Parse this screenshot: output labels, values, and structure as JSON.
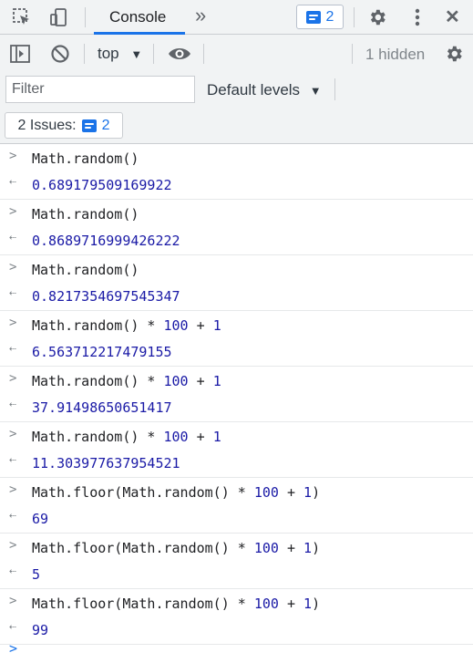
{
  "tabbar": {
    "active_tab": "Console",
    "more_tabs": "»",
    "issues_badge_count": "2",
    "close": "✕"
  },
  "toolbar": {
    "context": "top",
    "hidden_count": "1 hidden"
  },
  "filterbar": {
    "filter_placeholder": "Filter",
    "levels": "Default levels"
  },
  "issues": {
    "label": "2 Issues:",
    "count": "2"
  },
  "entries": [
    {
      "input": "Math.random()",
      "output": "0.689179509169922"
    },
    {
      "input": "Math.random()",
      "output": "0.8689716999426222"
    },
    {
      "input": "Math.random()",
      "output": "0.8217354697545347"
    },
    {
      "input": "Math.random() * 100 + 1",
      "output": "6.563712217479155"
    },
    {
      "input": "Math.random() * 100 + 1",
      "output": "37.91498650651417"
    },
    {
      "input": "Math.random() * 100 + 1",
      "output": "11.303977637954521"
    },
    {
      "input": "Math.floor(Math.random() * 100 + 1)",
      "output": "69"
    },
    {
      "input": "Math.floor(Math.random() * 100 + 1)",
      "output": "5"
    },
    {
      "input": "Math.floor(Math.random() * 100 + 1)",
      "output": "99"
    }
  ],
  "colors": {
    "accent": "#1a73e8",
    "number": "#1a1aa6"
  }
}
